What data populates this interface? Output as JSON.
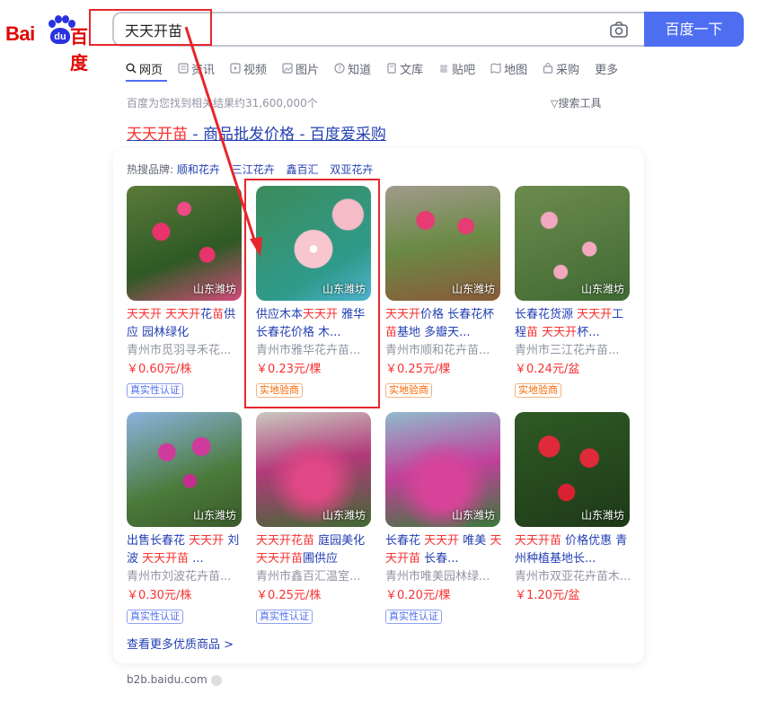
{
  "logo": {
    "left": "Bai",
    "paw": "du",
    "right": "百度"
  },
  "search": {
    "query": "天天开苗",
    "button": "百度一下"
  },
  "tabs": [
    {
      "label": "网页",
      "icon": "search-icon"
    },
    {
      "label": "资讯",
      "icon": "news-icon"
    },
    {
      "label": "视频",
      "icon": "video-icon"
    },
    {
      "label": "图片",
      "icon": "image-icon"
    },
    {
      "label": "知道",
      "icon": "question-icon"
    },
    {
      "label": "文库",
      "icon": "document-icon"
    },
    {
      "label": "贴吧",
      "icon": "tieba-icon"
    },
    {
      "label": "地图",
      "icon": "map-icon"
    },
    {
      "label": "采购",
      "icon": "bag-icon"
    },
    {
      "label": "更多",
      "icon": ""
    }
  ],
  "result_count": "百度为您找到相关结果约31,600,000个",
  "search_tools": "搜索工具",
  "result": {
    "title_hl": "天天开苗",
    "title_rest": " - 商品批发价格 - 百度爱采购"
  },
  "brands": {
    "label": "热搜品牌:",
    "items": [
      "顺和花卉",
      "三江花卉",
      "鑫百汇",
      "双亚花卉"
    ]
  },
  "products": [
    {
      "name_html": [
        [
          "hl",
          "天天开 天天开"
        ],
        [
          "n",
          "花"
        ],
        [
          "hl",
          "苗"
        ],
        [
          "n",
          "供应 园林绿化"
        ]
      ],
      "shop": "青州市觅羽寻禾花...",
      "price": "￥0.60元/株",
      "badge": "真实性认证",
      "badge_type": "blue",
      "loc": "山东潍坊"
    },
    {
      "name_html": [
        [
          "n",
          "供应木本"
        ],
        [
          "hl",
          "天天开"
        ],
        [
          "n",
          " 雅华长春花价格 木..."
        ]
      ],
      "shop": "青州市雅华花卉苗...",
      "price": "￥0.23元/棵",
      "badge": "实地验商",
      "badge_type": "orange",
      "loc": "山东潍坊"
    },
    {
      "name_html": [
        [
          "hl",
          "天天开"
        ],
        [
          "n",
          "价格 长春花杯"
        ],
        [
          "hl",
          "苗"
        ],
        [
          "n",
          "基地 多瓣天..."
        ]
      ],
      "shop": "青州市顺和花卉苗...",
      "price": "￥0.25元/棵",
      "badge": "实地验商",
      "badge_type": "orange",
      "loc": "山东潍坊"
    },
    {
      "name_html": [
        [
          "n",
          "长春花货源 "
        ],
        [
          "hl",
          "天天开"
        ],
        [
          "n",
          "工程"
        ],
        [
          "hl",
          "苗"
        ],
        [
          "n",
          " "
        ],
        [
          "hl",
          "天天开"
        ],
        [
          "n",
          "杯..."
        ]
      ],
      "shop": "青州市三江花卉苗...",
      "price": "￥0.24元/盆",
      "badge": "实地验商",
      "badge_type": "orange",
      "loc": "山东潍坊"
    },
    {
      "name_html": [
        [
          "n",
          "出售长春花 "
        ],
        [
          "hl",
          "天天开"
        ],
        [
          "n",
          " 刘波 "
        ],
        [
          "hl",
          "天天开苗"
        ],
        [
          "n",
          " ..."
        ]
      ],
      "shop": "青州市刘波花卉苗...",
      "price": "￥0.30元/株",
      "badge": "真实性认证",
      "badge_type": "blue",
      "loc": "山东潍坊"
    },
    {
      "name_html": [
        [
          "hl",
          "天天开花苗"
        ],
        [
          "n",
          " 庭园美化 "
        ],
        [
          "hl",
          "天天开苗"
        ],
        [
          "n",
          "圃供应"
        ]
      ],
      "shop": "青州市鑫百汇温室...",
      "price": "￥0.25元/株",
      "badge": "真实性认证",
      "badge_type": "blue",
      "loc": "山东潍坊"
    },
    {
      "name_html": [
        [
          "n",
          "长春花 "
        ],
        [
          "hl",
          "天天开"
        ],
        [
          "n",
          " 唯美 "
        ],
        [
          "hl",
          "天天开苗"
        ],
        [
          "n",
          " 长春..."
        ]
      ],
      "shop": "青州市唯美园林绿...",
      "price": "￥0.20元/棵",
      "badge": "真实性认证",
      "badge_type": "blue",
      "loc": "山东潍坊"
    },
    {
      "name_html": [
        [
          "hl",
          "天天开苗"
        ],
        [
          "n",
          " 价格优惠 青州种植基地长..."
        ]
      ],
      "shop": "青州市双亚花卉苗木...",
      "price": "￥1.20元/盆",
      "badge": "",
      "badge_type": "blue",
      "loc": "山东潍坊"
    }
  ],
  "more_link": "查看更多优质商品 >",
  "domain": "b2b.baidu.com",
  "colors": {
    "accent": "#4e6ef2",
    "highlight": "#f73131",
    "link": "#2440b3",
    "annotation": "#e8262b"
  }
}
